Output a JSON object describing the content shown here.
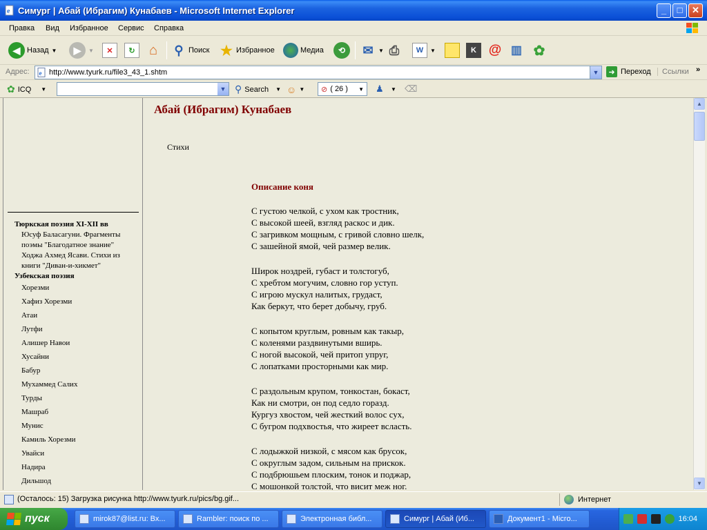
{
  "window": {
    "title": "Симург | Абай (Ибрагим) Кунабаев - Microsoft Internet Explorer"
  },
  "menu": [
    "Правка",
    "Вид",
    "Избранное",
    "Сервис",
    "Справка"
  ],
  "toolbar": {
    "back_label": "Назад",
    "search_label": "Поиск",
    "favorites_label": "Избранное",
    "media_label": "Медиа"
  },
  "address": {
    "label": "Адрес:",
    "url": "http://www.tyurk.ru/file3_43_1.shtm",
    "go_label": "Переход",
    "links_label": "Ссылки"
  },
  "icq": {
    "icq_label": "ICQ",
    "search_value": "",
    "search_label": "Search",
    "counter": "( 26 )"
  },
  "sidebar": {
    "section1": "Тюркская поэзия XI-XII вв",
    "sub1": "Юсуф Баласагуни. Фрагменты поэмы \"Благодатное знание\"",
    "sub2": "Ходжа Ахмед Ясави. Стихи из книги \"Диван-и-хикмет\"",
    "section2": "Узбекская поэзия",
    "items": [
      "Хорезми",
      "Хафиз Хорезми",
      "Атаи",
      "Лутфи",
      "Алишер Навои",
      "Хусайни",
      "Бабур",
      "Мухаммед Салих",
      "Турды",
      "Машраб",
      "Мунис",
      "Камиль Хорезми",
      "Увайси",
      "Надира",
      "Дильшод"
    ]
  },
  "content": {
    "author": "Абай (Ибрагим) Кунабаев",
    "section": "Стихи",
    "poem_title": "Описание коня",
    "stanzas": [
      [
        "С густою челкой, с ухом как тростник,",
        "С высокой шеей, взгляд раскос и дик.",
        "С загривком мощным, с гривой словно шелк,",
        "С зашейной ямой, чей размер велик."
      ],
      [
        "Широк ноздрей, губаст и толстогуб,",
        "С хребтом могучим, словно гор уступ.",
        "С игрою мускул налитых, грудаст,",
        "Как беркут, что берет добычу, груб."
      ],
      [
        "С копытом круглым, ровным как такыр,",
        "С коленями раздвинутыми вширь.",
        "С ногой высокой, чей притоп упруг,",
        "С лопатками просторными как мир."
      ],
      [
        "С раздольным крупом, тонкостан, бокаст,",
        "Как ни смотри, он под седло горазд.",
        "Кургуз хвостом, чей жесткий волос сух,",
        "С бугром подхвостья, что жиреет всласть."
      ],
      [
        "С лодыжкой низкой, с мясом как брусок,",
        "С округлым задом, сильным на прискок.",
        "С подбрюшьем плоским, тонок и поджар,",
        "С мошонкой толстой, что висит меж ног."
      ]
    ]
  },
  "status": {
    "text": "(Осталось: 15) Загрузка рисунка http://www.tyurk.ru/pics/bg.gif...",
    "zone": "Интернет"
  },
  "taskbar": {
    "start_label": "пуск",
    "tasks": [
      "mirok87@list.ru: Вх...",
      "Rambler: поиск по ...",
      "Электронная библ...",
      "Симург | Абай (Иб...",
      "Документ1 - Micro..."
    ],
    "clock": "16:04"
  },
  "colors": {
    "heading": "#800000",
    "content_bg": "#ecebdd",
    "titlebar": "#0a4fd6"
  }
}
